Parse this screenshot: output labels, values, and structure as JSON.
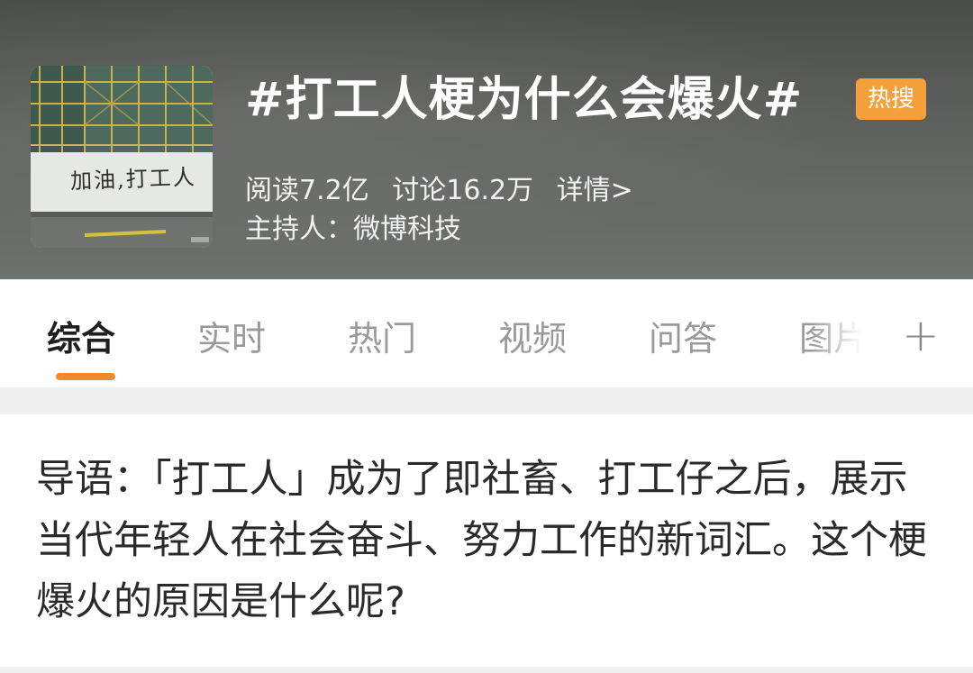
{
  "header": {
    "topic_title": "#打工人梗为什么会爆火#",
    "hot_badge": "热搜",
    "reads": "阅读7.2亿",
    "discussions": "讨论16.2万",
    "details_link": "详情>",
    "host": "主持人：微博科技",
    "cover_graffiti": "加油,打工人"
  },
  "tabs": [
    {
      "label": "综合",
      "active": true
    },
    {
      "label": "实时",
      "active": false
    },
    {
      "label": "热门",
      "active": false
    },
    {
      "label": "视频",
      "active": false
    },
    {
      "label": "问答",
      "active": false
    },
    {
      "label": "图片",
      "active": false
    }
  ],
  "tab_add_label": "+",
  "guide": {
    "text": "导语：「打工人」成为了即社畜、打工仔之后，展示当代年轻人在社会奋斗、努力工作的新词汇。这个梗爆火的原因是什么呢?"
  },
  "colors": {
    "accent": "#f08a2d",
    "badge": "#f5a03a",
    "active_tab": "#1f1f1f",
    "inactive_tab": "#9a9a9a"
  }
}
